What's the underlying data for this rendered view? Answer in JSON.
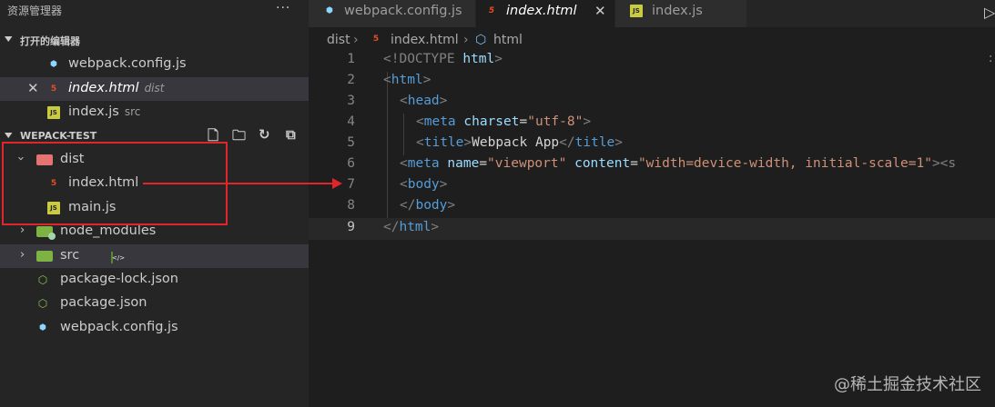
{
  "sidebar": {
    "title": "资源管理器",
    "more": "···",
    "open_editors": {
      "header": "打开的编辑器",
      "items": [
        {
          "label": "webpack.config.js",
          "desc": "",
          "icon": "webpack-icon"
        },
        {
          "label": "index.html",
          "desc": "dist",
          "icon": "html-icon"
        },
        {
          "label": "index.js",
          "desc": "src",
          "icon": "js-icon"
        }
      ]
    },
    "project": {
      "header": "WEPACK-TEST",
      "tree": [
        {
          "label": "dist",
          "type": "folder",
          "expanded": true
        },
        {
          "label": "index.html",
          "type": "file",
          "icon": "html-icon"
        },
        {
          "label": "main.js",
          "type": "file",
          "icon": "js-icon"
        },
        {
          "label": "node_modules",
          "type": "folder",
          "expanded": false
        },
        {
          "label": "src",
          "type": "folder",
          "expanded": false
        },
        {
          "label": "package-lock.json",
          "type": "file",
          "icon": "json-icon"
        },
        {
          "label": "package.json",
          "type": "file",
          "icon": "json-icon"
        },
        {
          "label": "webpack.config.js",
          "type": "file",
          "icon": "webpack-icon"
        }
      ]
    }
  },
  "tabs": [
    {
      "label": "webpack.config.js",
      "icon": "webpack-icon",
      "active": false
    },
    {
      "label": "index.html",
      "icon": "html-icon",
      "active": true
    },
    {
      "label": "index.js",
      "icon": "js-icon",
      "active": false
    }
  ],
  "breadcrumb": [
    "dist",
    "index.html",
    "html"
  ],
  "editor": {
    "current_line": 9,
    "lines": [
      {
        "n": "1"
      },
      {
        "n": "2"
      },
      {
        "n": "3"
      },
      {
        "n": "4"
      },
      {
        "n": "5"
      },
      {
        "n": "6"
      },
      {
        "n": "7"
      },
      {
        "n": "8"
      },
      {
        "n": "9"
      }
    ],
    "code": {
      "l1_doctype": "<!DOCTYPE",
      "l1_html": "html",
      "l1_close": ">",
      "l2_open": "<",
      "l2_tag": "html",
      "l2_close": ">",
      "l3_open": "<",
      "l3_tag": "head",
      "l3_close": ">",
      "l4_open": "<",
      "l4_tag": "meta",
      "l4_attr": "charset",
      "l4_eq": "=",
      "l4_val": "\"utf-8\"",
      "l4_close": ">",
      "l5_open": "<",
      "l5_tag": "title",
      "l5_close": ">",
      "l5_text": "Webpack App",
      "l5_end_open": "</",
      "l5_end_tag": "title",
      "l5_end_close": ">",
      "l6_open": "<",
      "l6_tag": "meta",
      "l6_attr1": "name",
      "l6_eq": "=",
      "l6_val1": "\"viewport\"",
      "l6_attr2": "content",
      "l6_val2": "\"width=device-width, initial-scale=1\"",
      "l6_rest": "><s",
      "l7_open": "<",
      "l7_tag": "body",
      "l7_close": ">",
      "l8_open": "</",
      "l8_tag": "body",
      "l8_close": ">",
      "l9_open": "</",
      "l9_tag": "html",
      "l9_close": ">"
    }
  },
  "watermark": "@稀土掘金技术社区",
  "colors": {
    "annotation_red": "#e0262b",
    "tag_blue": "#569cd6",
    "attr_lightblue": "#9cdcfe",
    "string_orange": "#ce9178"
  }
}
